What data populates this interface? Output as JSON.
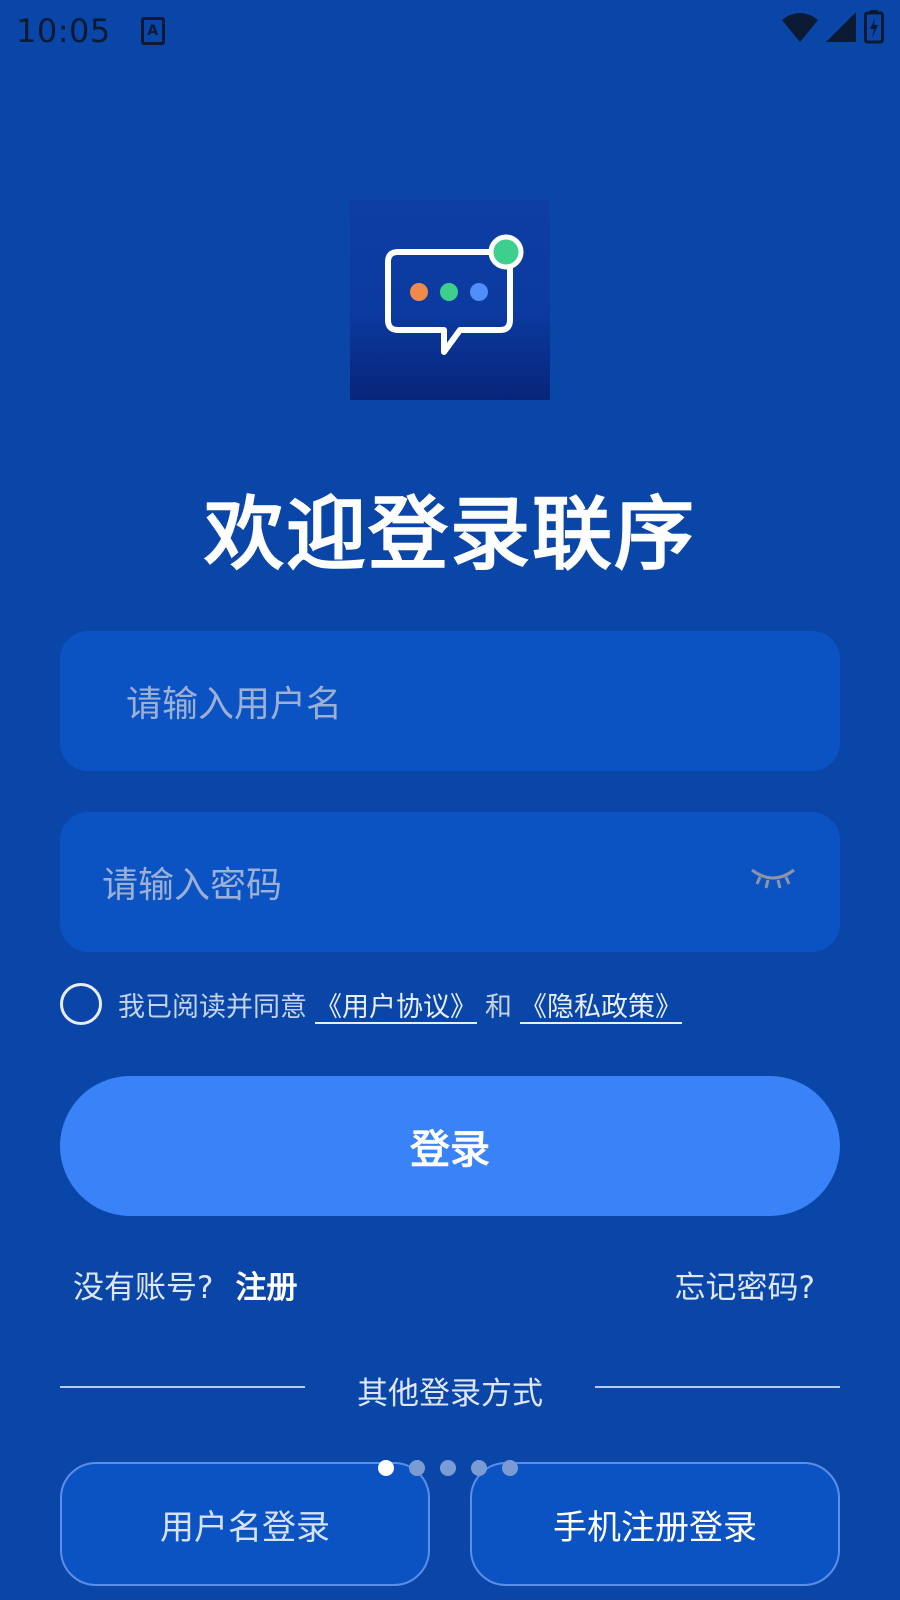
{
  "status_bar": {
    "time": "10:05",
    "keyboard_indicator": "A"
  },
  "app": {
    "logo_icon": "chat-bubble-logo-icon",
    "dot_colors": [
      "#ef8a4a",
      "#3ecf8e",
      "#4f8ff7"
    ],
    "notification_color": "#3ecf8e"
  },
  "welcome_title": "欢迎登录联序",
  "username_field": {
    "placeholder": "请输入用户名",
    "value": ""
  },
  "password_field": {
    "placeholder": "请输入密码",
    "value": "",
    "toggle_icon": "eye-closed-icon"
  },
  "agreement": {
    "checked": false,
    "prefix": "我已阅读并同意",
    "user_agreement": "《用户协议》",
    "and": "和",
    "privacy_policy": "《隐私政策》"
  },
  "login_button": "登录",
  "no_account": "没有账号?",
  "register_link": "注册",
  "forgot_password": "忘记密码?",
  "other_methods": "其他登录方式",
  "pager": {
    "count": 5,
    "active": 0
  },
  "alt_logins": {
    "username": "用户名登录",
    "phone": "手机注册登录"
  },
  "colors": {
    "background": "#0a45a8",
    "field": "#0b52c2",
    "primary": "#3a82f7"
  }
}
